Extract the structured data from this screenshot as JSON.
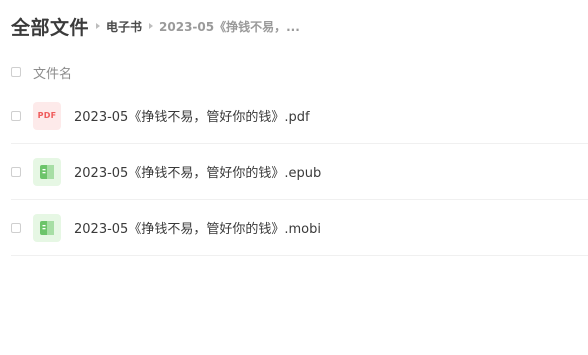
{
  "breadcrumb": {
    "root": "全部文件",
    "folder": "电子书",
    "current": "2023-05《挣钱不易，..."
  },
  "list": {
    "header_label": "文件名",
    "files": [
      {
        "name": "2023-05《挣钱不易，管好你的钱》.pdf",
        "icon": "pdf-icon",
        "icon_text": "PDF",
        "icon_color": "#ef5b5b"
      },
      {
        "name": "2023-05《挣钱不易，管好你的钱》.epub",
        "icon": "ebook-icon",
        "icon_color": "#5cb85c"
      },
      {
        "name": "2023-05《挣钱不易，管好你的钱》.mobi",
        "icon": "ebook-icon",
        "icon_color": "#5cb85c"
      }
    ]
  }
}
